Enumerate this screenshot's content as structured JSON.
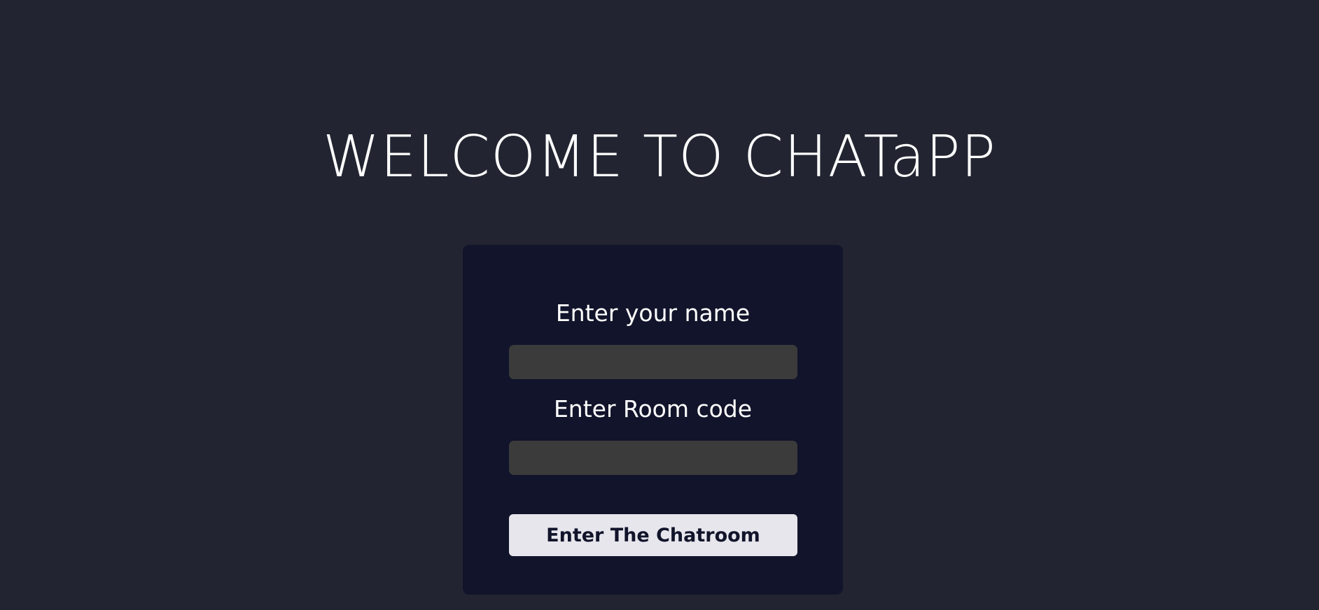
{
  "page": {
    "title": "WELCOME TO CHATaPP"
  },
  "form": {
    "name_label": "Enter your name",
    "name_value": "",
    "room_label": "Enter Room code",
    "room_value": "",
    "submit_label": "Enter The Chatroom"
  },
  "colors": {
    "background": "#222531",
    "card": "#11142a",
    "input": "#3b3b3b",
    "button": "#e6e6ec",
    "text": "#ffffff"
  }
}
